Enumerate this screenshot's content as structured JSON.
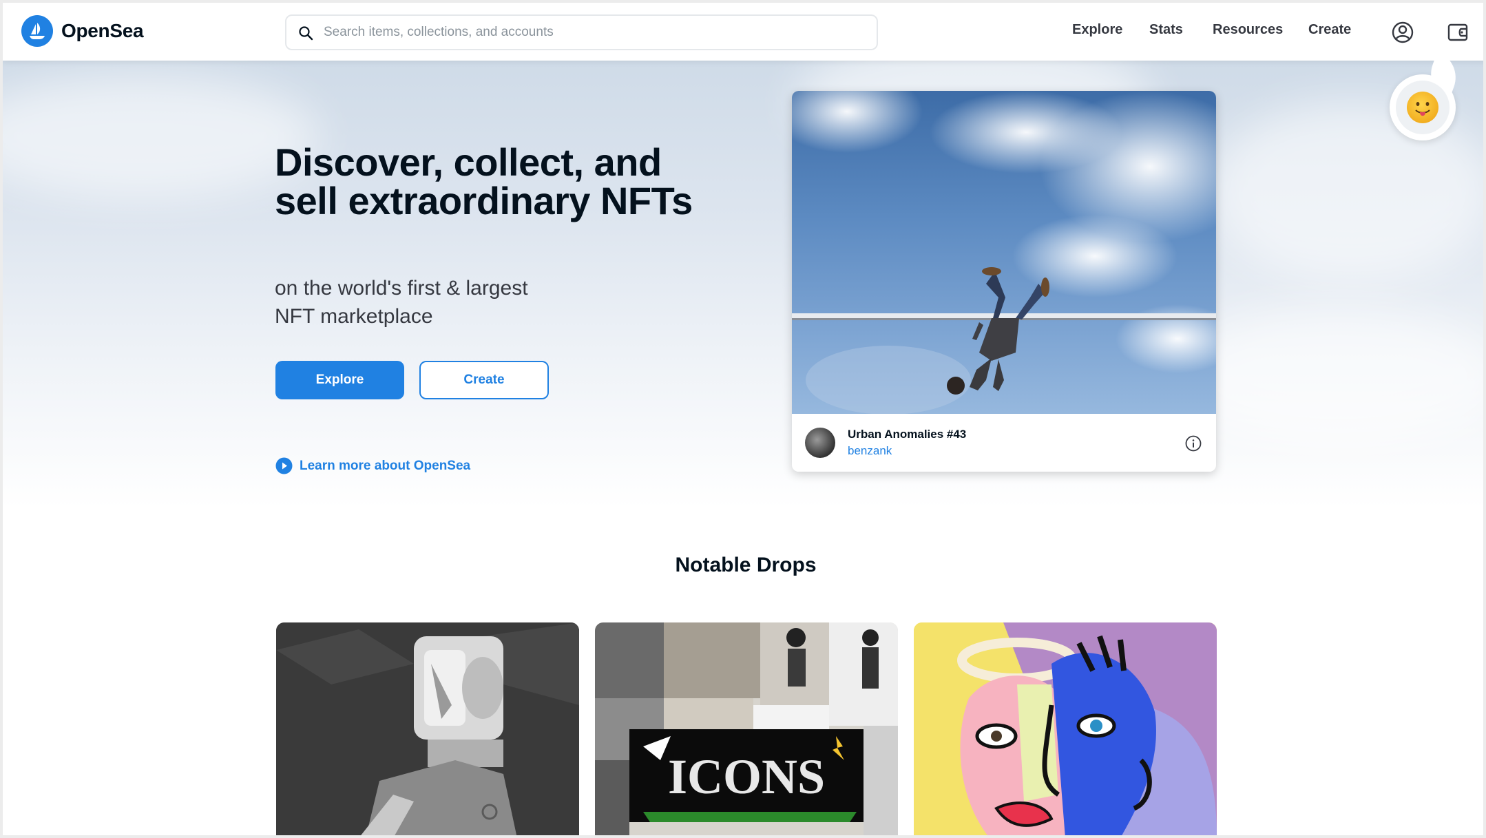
{
  "header": {
    "logo_text": "OpenSea",
    "search_placeholder": "Search items, collections, and accounts",
    "nav": [
      "Explore",
      "Stats",
      "Resources",
      "Create"
    ]
  },
  "hero": {
    "title": "Discover, collect, and sell extraordinary NFTs",
    "subtitle": "on the world's first & largest NFT marketplace",
    "explore_label": "Explore",
    "create_label": "Create",
    "learn_label": "Learn more about OpenSea"
  },
  "featured": {
    "name": "Urban Anomalies #43",
    "creator": "benzank"
  },
  "notable": {
    "title": "Notable Drops",
    "drop2_text": "ICONS"
  },
  "colors": {
    "accent": "#2081e2",
    "text": "#04111d"
  }
}
